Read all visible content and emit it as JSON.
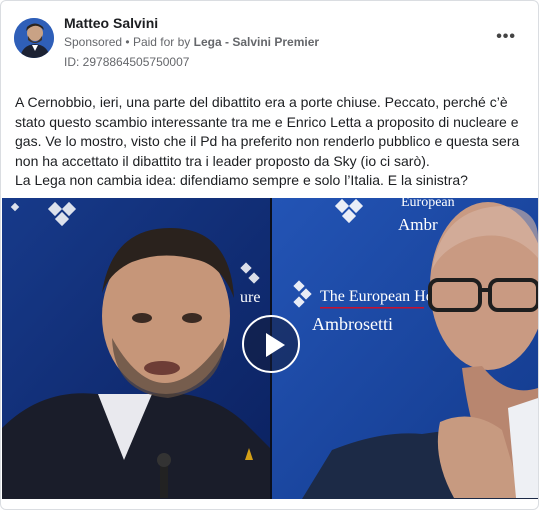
{
  "advertiser": {
    "name": "Matteo Salvini",
    "sponsored_label": "Sponsored",
    "paid_for_prefix": "Paid for by",
    "paid_for_by": "Lega - Salvini Premier",
    "ad_id": "ID: 2978864505750007"
  },
  "more_icon": "ellipsis-icon",
  "body_text": {
    "paragraph_1": "A Cernobbio, ieri, una parte del dibattito era a porte chiuse. Peccato, perché c’è stato questo scambio interessante tra me e Enrico Letta a proposito di nucleare e gas. Ve lo mostro, visto che il Pd ha preferito non renderlo pubblico e questa sera non ha accettato il dibattito tra i leader proposto da Sky (io ci sarò).",
    "paragraph_2": "La Lega non cambia idea: difendiamo sempre e solo l’Italia. E la sinistra?"
  },
  "video": {
    "backdrop_left_text": "ure",
    "backdrop_right_line_1": "The European House",
    "backdrop_right_line_2": "Ambrosetti",
    "backdrop_top_line_1": "European",
    "backdrop_top_line_2": "Ambr",
    "play_icon": "play-icon"
  },
  "colors": {
    "secondary_text": "#65676b",
    "video_backdrop": "#0f2b6e"
  }
}
